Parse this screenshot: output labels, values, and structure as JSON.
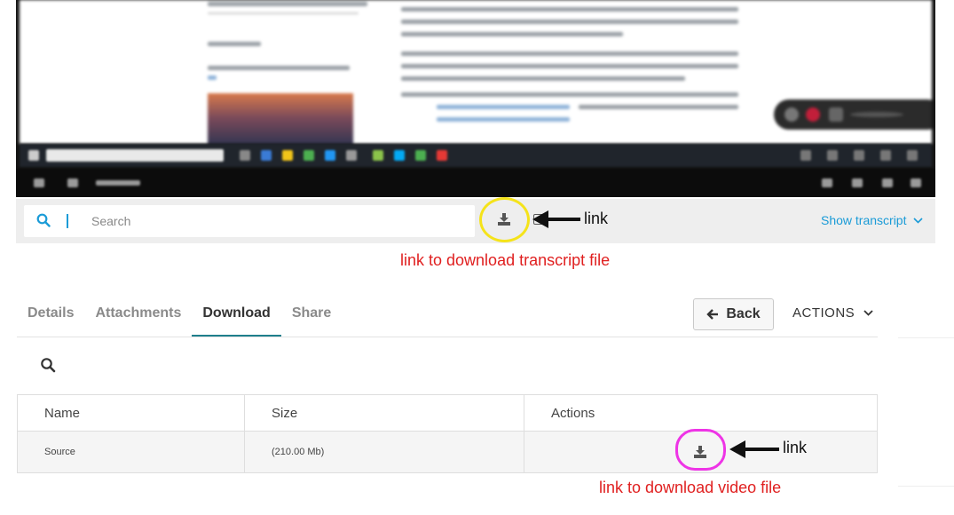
{
  "transcript_bar": {
    "search_placeholder": "Search",
    "show_transcript_label": "Show transcript",
    "download_icon": "download-icon"
  },
  "annotations": {
    "link_top": "link",
    "caption_top": "link to download transcript file",
    "link_bottom": "link",
    "caption_bottom": "link to download video file",
    "color_caption": "#e02020",
    "color_ring_top": "#f5e31a",
    "color_ring_bottom": "#ee34e6"
  },
  "tabs": [
    {
      "label": "Details",
      "active": false
    },
    {
      "label": "Attachments",
      "active": false
    },
    {
      "label": "Download",
      "active": true
    },
    {
      "label": "Share",
      "active": false
    }
  ],
  "toolbar": {
    "back_label": "Back",
    "actions_label": "ACTIONS"
  },
  "table": {
    "headers": [
      "Name",
      "Size",
      "Actions"
    ],
    "rows": [
      {
        "name": "Source",
        "size": "(210.00 Mb)"
      }
    ]
  },
  "colors": {
    "accent": "#1a9bd7",
    "tab_underline": "#1e7f8c"
  }
}
